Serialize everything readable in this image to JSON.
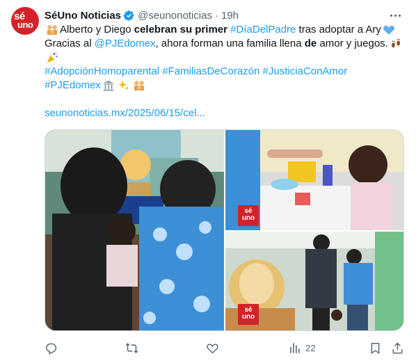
{
  "author": {
    "name": "SéUno Noticias",
    "handle": "@seunonoticias",
    "separator": "·",
    "time": "19h",
    "avatar_text_top": "sé",
    "avatar_text_bottom": "uno"
  },
  "text": {
    "l1_a": "Alberto y Diego ",
    "l1_b": "celebran su primer",
    "l1_c": " ",
    "l1_tag": "#DíaDelPadre",
    "l1_d": " tras adoptar a Ary",
    "l2_a": "Gracias al ",
    "l2_mention": "@PJEdomex",
    "l2_b": ", ahora forman una familia llena ",
    "l2_bold": "de",
    "l2_c": " amor y juegos.",
    "tag1": "#AdopciónHomoparental",
    "tag2": "#FamiliasDeCorazón",
    "tag3": "#JusticiaConAmor",
    "tag4": "#PJEdomex",
    "link": "seunonoticias.mx/2025/06/15/cel..."
  },
  "media": {
    "watermark_top": "sé",
    "watermark_bottom": "uno"
  },
  "actions": {
    "views": "22"
  },
  "colors": {
    "link": "#1d9bf0",
    "muted": "#536471",
    "brand": "#d3222a",
    "verified": "#1d9bf0"
  }
}
